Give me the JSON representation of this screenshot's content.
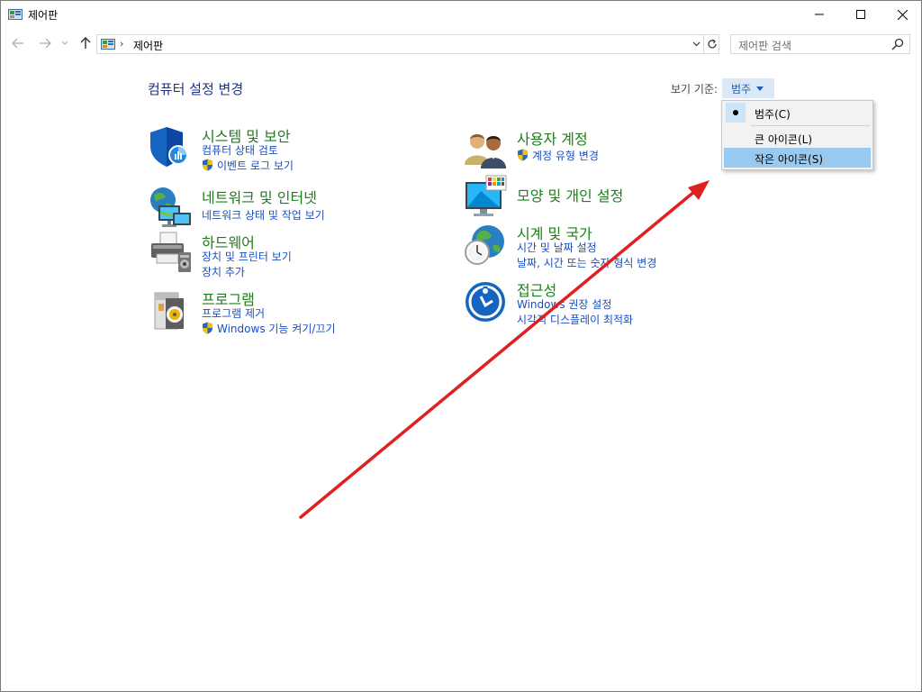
{
  "window": {
    "title": "제어판"
  },
  "nav": {
    "address": "제어판",
    "breadcrumb_sep": "›"
  },
  "search": {
    "placeholder": "제어판 검색"
  },
  "main": {
    "title": "컴퓨터 설정 변경",
    "view_by_label": "보기 기준:",
    "view_by_value": "범주"
  },
  "categories": [
    {
      "title": "시스템 및 보안",
      "links": [
        "컴퓨터 상태 검토",
        "이벤트 로그 보기"
      ],
      "icon": "shield-icon"
    },
    {
      "title": "네트워크 및 인터넷",
      "links": [
        "네트워크 상태 및 작업 보기"
      ],
      "icon": "network-icon"
    },
    {
      "title": "하드웨어",
      "links": [
        "장치 및 프린터 보기",
        "장치 추가"
      ],
      "icon": "printer-icon"
    },
    {
      "title": "프로그램",
      "links": [
        "프로그램 제거",
        "Windows 기능 켜기/끄기"
      ],
      "icon": "programs-icon"
    },
    {
      "title": "사용자 계정",
      "links": [
        "계정 유형 변경"
      ],
      "icon": "users-icon"
    },
    {
      "title": "모양 및 개인 설정",
      "links": [],
      "icon": "appearance-icon"
    },
    {
      "title": "시계 및 국가",
      "links": [
        "시간 및 날짜 설정",
        "날짜, 시간 또는 숫자 형식 변경"
      ],
      "icon": "clock-globe-icon"
    },
    {
      "title": "접근성",
      "links": [
        "Windows 권장 설정",
        "시각적 디스플레이 최적화"
      ],
      "icon": "accessibility-icon"
    }
  ],
  "view_menu": {
    "items": [
      "범주(C)",
      "큰 아이콘(L)",
      "작은 아이콘(S)"
    ],
    "selected": "범주(C)",
    "highlighted": "작은 아이콘(S)"
  },
  "colors": {
    "category_title": "#1e7e1e",
    "link": "#1a4fc0",
    "page_title": "#1e3287",
    "annotation_arrow": "#e02020"
  }
}
